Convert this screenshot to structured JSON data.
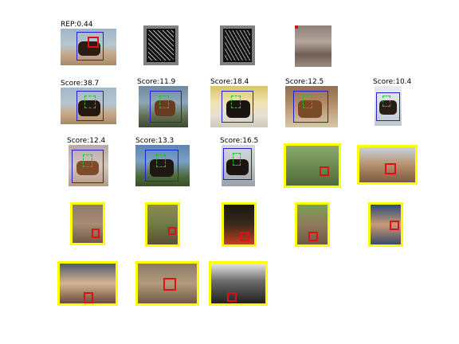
{
  "row1": {
    "rep_label": "REP:0.44",
    "glyph_left_icon": "hog-glyph-icon",
    "glyph_right_icon": "hog-glyph-icon",
    "mean_image_icon": "average-image-icon"
  },
  "row2": {
    "scores": [
      "Score:38.7",
      "Score:11.9",
      "Score:18.4",
      "Score:12.5",
      "Score:10.4"
    ]
  },
  "row3": {
    "scores": [
      "Score:12.4",
      "Score:13.3",
      "Score:16.5"
    ]
  },
  "colors": {
    "detection_box": "#2020d0",
    "part_box": "#e01010",
    "negative_frame": "#ffff00",
    "glyph_frame": "#808080"
  }
}
